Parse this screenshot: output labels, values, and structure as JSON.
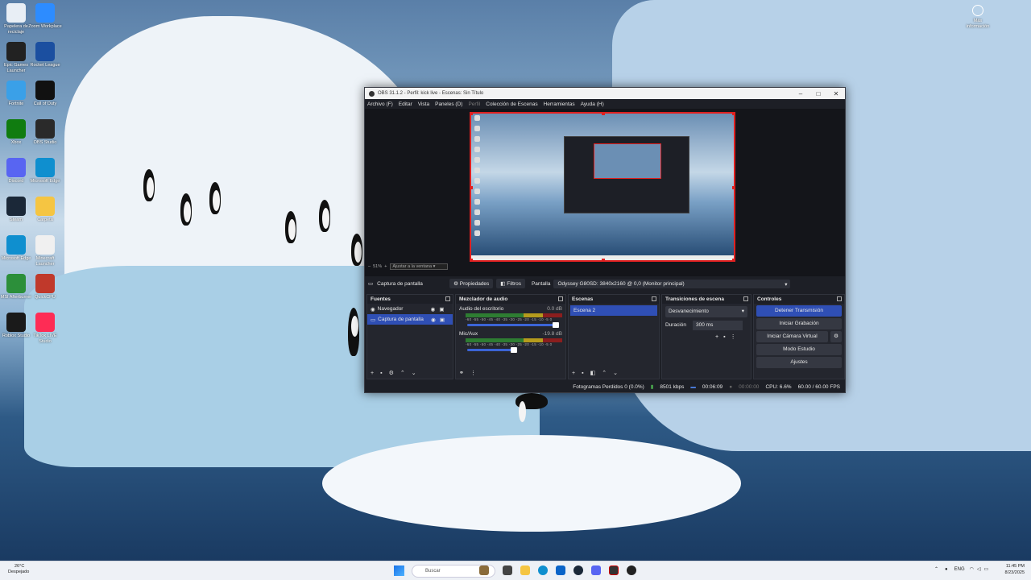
{
  "desktop": {
    "icons": [
      {
        "label": "Papelera de reciclaje",
        "icon": "recycle-bin-icon",
        "color": "#e8eef5"
      },
      {
        "label": "Zoom Workplace",
        "icon": "zoom-icon",
        "color": "#2d8cff"
      },
      {
        "label": "Epic Games Launcher",
        "icon": "epic-games-icon",
        "color": "#222222"
      },
      {
        "label": "Rocket League",
        "icon": "rocket-league-icon",
        "color": "#1b4fa0"
      },
      {
        "label": "Fortnite",
        "icon": "fortnite-icon",
        "color": "#3aa0e8"
      },
      {
        "label": "Call of Duty",
        "icon": "call-of-duty-icon",
        "color": "#111111"
      },
      {
        "label": "Xbox",
        "icon": "xbox-icon",
        "color": "#107c10"
      },
      {
        "label": "OBS Studio",
        "icon": "obs-icon",
        "color": "#2a2a2a"
      },
      {
        "label": "Discord",
        "icon": "discord-icon",
        "color": "#5865f2"
      },
      {
        "label": "Microsoft Edge",
        "icon": "edge-icon",
        "color": "#0f8fcf"
      },
      {
        "label": "Steam",
        "icon": "steam-icon",
        "color": "#1b2838"
      },
      {
        "label": "Carpeta",
        "icon": "folder-icon",
        "color": "#f5c542"
      },
      {
        "label": "Microsoft Edge",
        "icon": "edge-icon",
        "color": "#0f8fcf"
      },
      {
        "label": "Minecraft Launcher",
        "icon": "file-icon",
        "color": "#f0f0f0"
      },
      {
        "label": "MSI Afterburner",
        "icon": "afterburner-icon",
        "color": "#2c8f3a"
      },
      {
        "label": "QuickCPU",
        "icon": "quickcpu-icon",
        "color": "#c0392b"
      },
      {
        "label": "Roblox Studio",
        "icon": "roblox-studio-icon",
        "color": "#1a1a1a"
      },
      {
        "label": "TikTok LIVE Studio",
        "icon": "tiktok-icon",
        "color": "#fe2c55"
      }
    ],
    "top_right_label": "Más información"
  },
  "obs": {
    "title": "OBS 31.1.2 - Perfil: kick live - Escenas: Sin Título",
    "menu": [
      "Archivo (F)",
      "Editar",
      "Vista",
      "Paneles (D)",
      "Perfil",
      "Colección de Escenas",
      "Herramientas",
      "Ayuda (H)"
    ],
    "zoom": "51%",
    "zoom_select": "Ajustar a la ventana",
    "source_label": "Captura de pantalla",
    "properties": "Propiedades",
    "filters": "Filtros",
    "display_label": "Pantalla",
    "display_value": "Odyssey G80SD: 3840x2160 @ 0,0 (Monitor principal)",
    "sources": {
      "title": "Fuentes",
      "items": [
        "Navegador",
        "Captura de pantalla"
      ]
    },
    "mixer": {
      "title": "Mezclador de audio",
      "channels": [
        {
          "name": "Audio del escritorio",
          "db": "0.0 dB"
        },
        {
          "name": "Mic/Aux",
          "db": "-19.8 dB"
        }
      ],
      "scale": "-60 -55 -50 -45 -40 -35 -30 -25 -20 -15 -10 -5 0"
    },
    "scenes": {
      "title": "Escenas",
      "items": [
        "Escena 2"
      ]
    },
    "transitions": {
      "title": "Transiciones de escena",
      "type": "Desvanecimiento",
      "duration_label": "Duración",
      "duration": "300 ms"
    },
    "controls": {
      "title": "Controles",
      "buttons": [
        "Detener Transmisión",
        "Iniciar Grabación",
        "Iniciar Cámara Virtual",
        "Modo Estudio",
        "Ajustes"
      ]
    },
    "status": {
      "dropped": "Fotogramas Perdidos 0 (0.0%)",
      "bitrate": "8501 kbps",
      "stream_time": "00:06:09",
      "rec_time": "00:00:00",
      "cpu": "CPU: 6.6%",
      "fps": "60.00 / 60.00 FPS"
    }
  },
  "taskbar": {
    "weather_temp": "26°C",
    "weather_desc": "Despejado",
    "search": "Buscar",
    "lang": "ENG",
    "time": "11:45 PM",
    "date": "8/23/2025"
  }
}
